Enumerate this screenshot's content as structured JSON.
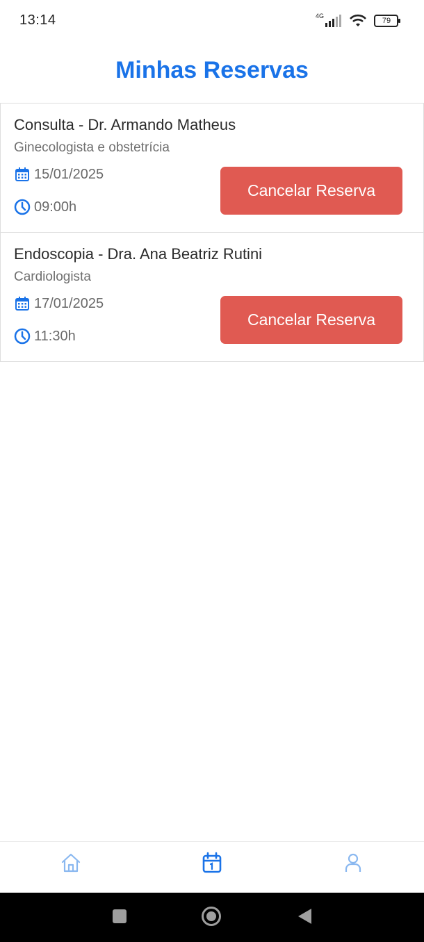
{
  "status_bar": {
    "time": "13:14",
    "network_label": "4G",
    "battery_level": "79"
  },
  "header": {
    "title": "Minhas Reservas"
  },
  "reservations": [
    {
      "title": "Consulta - Dr. Armando Matheus",
      "specialty": "Ginecologista e obstetrícia",
      "date": "15/01/2025",
      "time": "09:00h",
      "cancel_label": "Cancelar Reserva"
    },
    {
      "title": "Endoscopia - Dra. Ana Beatriz Rutini",
      "specialty": "Cardiologista",
      "date": "17/01/2025",
      "time": "11:30h",
      "cancel_label": "Cancelar Reserva"
    }
  ],
  "bottom_nav": {
    "items": [
      {
        "icon": "home-icon",
        "active": false
      },
      {
        "icon": "calendar-icon",
        "active": true
      },
      {
        "icon": "user-icon",
        "active": false
      }
    ]
  },
  "colors": {
    "primary": "#1a73e8",
    "danger": "#e05a52",
    "nav_inactive": "#8ab8f0"
  }
}
